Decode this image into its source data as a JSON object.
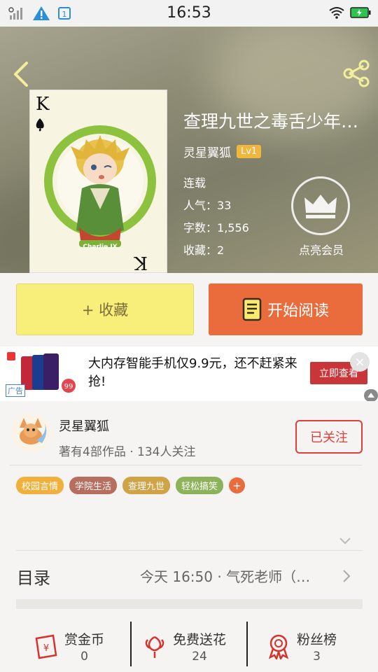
{
  "status_bar": {
    "time": "16:53"
  },
  "book": {
    "title": "查理九世之毒舌少年…",
    "author": "灵星翼狐",
    "level": "Lv1",
    "status": "连载",
    "popularity_label": "人气：",
    "popularity": "33",
    "words_label": "字数：",
    "words": "1,556",
    "favorites_label": "收藏：",
    "favorites": "2",
    "vip_label": "点亮会员"
  },
  "actions": {
    "favorite_label": "+ 收藏",
    "read_label": "开始阅读"
  },
  "ad": {
    "text": "大内存智能手机仅9.9元，还不赶紧来抢!",
    "cta": "立即查看",
    "tag": "广告",
    "close": "×",
    "price_badge": "99"
  },
  "author_card": {
    "name": "灵星翼狐",
    "meta": "著有4部作品 · 134人关注",
    "follow_label": "已关注",
    "tags": [
      {
        "label": "校园言情",
        "color": "#f0b13c"
      },
      {
        "label": "学院生活",
        "color": "#b86e5e"
      },
      {
        "label": "查理九世",
        "color": "#d0a347"
      },
      {
        "label": "轻松搞笑",
        "color": "#8db35a"
      }
    ],
    "add_tag": "+"
  },
  "toc": {
    "label": "目录",
    "latest": "今天 16:50 · 气死老师（…"
  },
  "bottom": {
    "items": [
      {
        "label": "赏金币",
        "value": "0",
        "icon": "red-envelope-icon"
      },
      {
        "label": "免费送花",
        "value": "24",
        "icon": "flower-icon"
      },
      {
        "label": "粉丝榜",
        "value": "3",
        "icon": "medal-icon"
      }
    ]
  },
  "colors": {
    "accent": "#ea6b3c",
    "favorite_bg": "#f7ef7a",
    "follow": "#d9423c",
    "icon_red": "#d7322c"
  }
}
